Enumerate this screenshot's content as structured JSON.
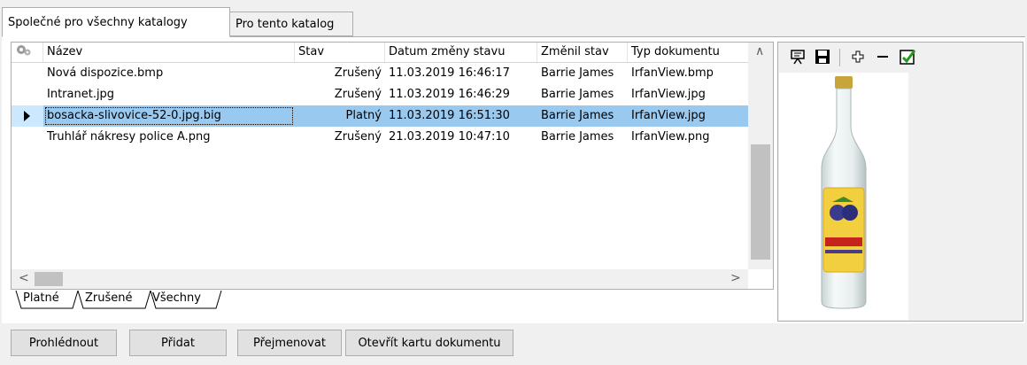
{
  "tabs": {
    "active": "Společné pro všechny katalogy",
    "inactive": "Pro tento katalog"
  },
  "grid": {
    "columns": [
      "Název",
      "Stav",
      "Datum změny stavu",
      "Změnil stav",
      "Typ dokumentu"
    ],
    "rows": [
      {
        "name": "Nová dispozice.bmp",
        "status": "Zrušený",
        "date": "11.03.2019 16:46:17",
        "user": "Barrie James",
        "type": "IrfanView.bmp"
      },
      {
        "name": "Intranet.jpg",
        "status": "Zrušený",
        "date": "11.03.2019 16:46:29",
        "user": "Barrie James",
        "type": "IrfanView.jpg"
      },
      {
        "name": "bosacka-slivovice-52-0.jpg.big",
        "status": "Platný",
        "date": "11.03.2019 16:51:30",
        "user": "Barrie James",
        "type": "IrfanView.jpg"
      },
      {
        "name": "Truhlář nákresy police A.png",
        "status": "Zrušený",
        "date": "21.03.2019 10:47:10",
        "user": "Barrie James",
        "type": "IrfanView.png"
      }
    ],
    "selected_row": 2
  },
  "subtabs": [
    "Platné",
    "Zrušené",
    "Všechny"
  ],
  "buttons": {
    "view": "Prohlédnout",
    "add": "Přidat",
    "rename": "Přejmenovat",
    "open_card": "Otevřít kartu dokumentu"
  },
  "colors": {
    "selection": "#99c9ef",
    "row_highlight": "#cce8ff"
  },
  "icons": [
    "settings-gears-icon",
    "presentation-icon",
    "save-icon",
    "plus-icon",
    "minus-icon",
    "checkbox-icon",
    "row-indicator-icon"
  ]
}
